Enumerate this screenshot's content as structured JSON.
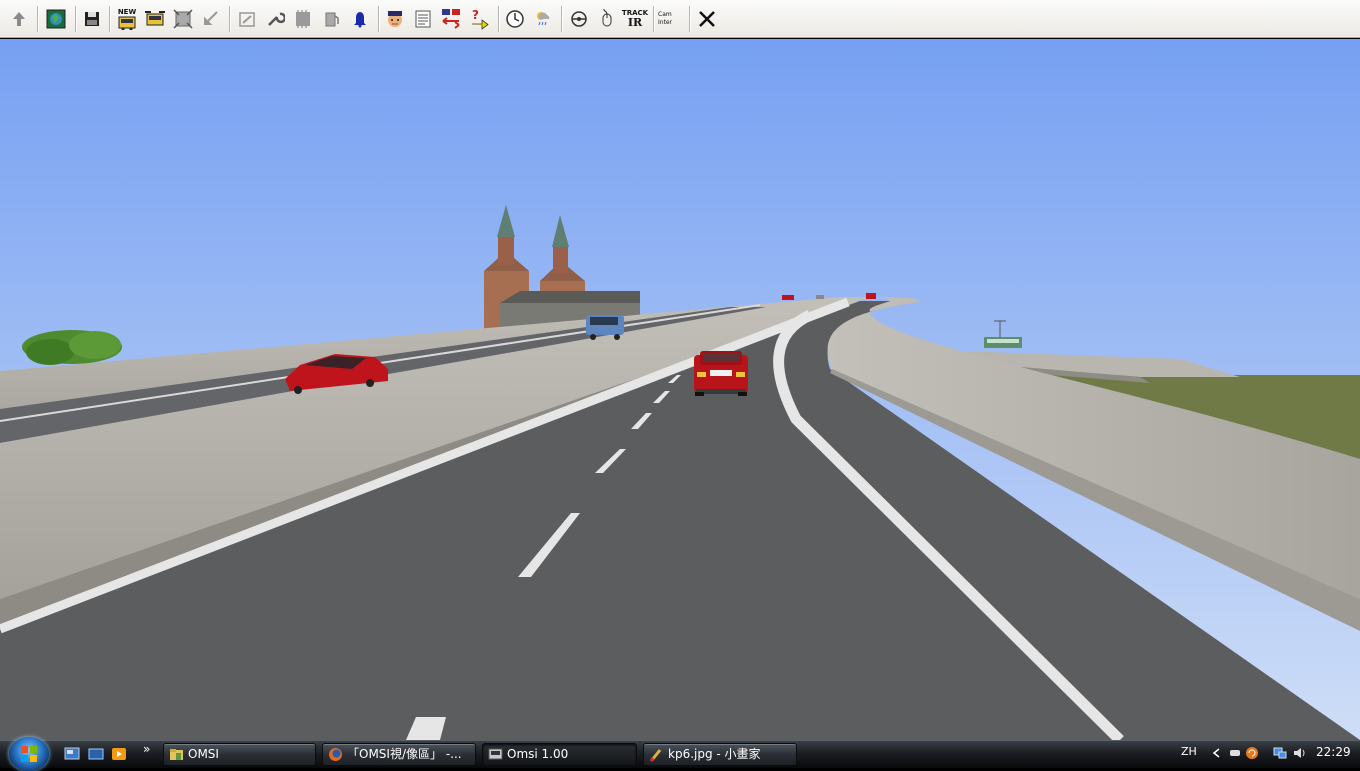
{
  "app": {
    "name": "OMSI"
  },
  "toolbar": {
    "new_label": "NEW",
    "track_label": "TRACK",
    "ir_label": "IR",
    "cam_label": "Cam",
    "cam_sub_label": "Inter"
  },
  "taskbar": {
    "tasks": [
      {
        "label": "OMSI"
      },
      {
        "label": "「OMSI視/像區」 -..."
      },
      {
        "label": "Omsi 1.00"
      },
      {
        "label": "kp6.jpg - 小畫家"
      }
    ],
    "language": "ZH",
    "clock": "22:29",
    "quicklaunch_more": "»"
  },
  "colors": {
    "sky_top": "#76a0f2",
    "sky_bottom": "#cfdef7",
    "asphalt": "#5c5d5f",
    "concrete": "#b5b1ab",
    "grass": "#6f7a46",
    "car_red": "#c0141c",
    "car_blue": "#5d86bf",
    "bus_green": "#5c8f68"
  }
}
